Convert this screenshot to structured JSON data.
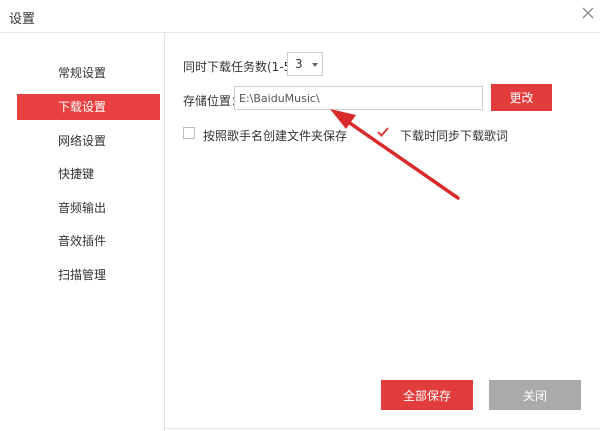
{
  "window": {
    "title": "设置"
  },
  "sidebar": {
    "items": [
      {
        "label": "常规设置",
        "active": false
      },
      {
        "label": "下载设置",
        "active": true
      },
      {
        "label": "网络设置",
        "active": false
      },
      {
        "label": "快捷键",
        "active": false
      },
      {
        "label": "音频输出",
        "active": false
      },
      {
        "label": "音效插件",
        "active": false
      },
      {
        "label": "扫描管理",
        "active": false
      }
    ]
  },
  "download": {
    "tasks_label": "同时下载任务数(1-5)",
    "tasks_value": "3",
    "path_label": "存储位置：",
    "path_value": "E:\\BaiduMusic\\",
    "change_button": "更改",
    "folder_option": {
      "label": "按照歌手名创建文件夹保存",
      "checked": false
    },
    "lyrics_option": {
      "label": "下载时同步下载歌词",
      "checked": true
    }
  },
  "footer": {
    "save_button": "全部保存",
    "close_button": "关闭"
  },
  "colors": {
    "accent": "#e23c3c",
    "annotation_arrow": "#d92b2b",
    "disabled_button": "#aaaaaa"
  },
  "icons": {
    "close": "close-icon",
    "dropdown": "chevron-down-icon",
    "check": "checkmark-icon"
  }
}
